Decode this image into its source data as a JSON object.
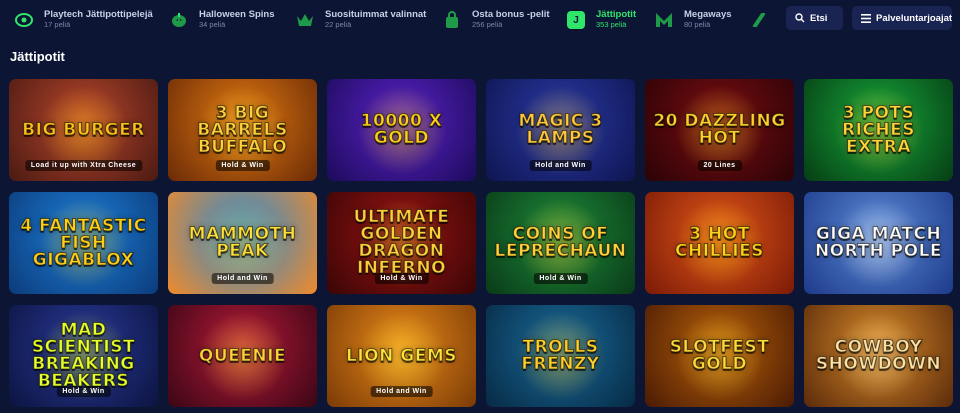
{
  "topbar": {
    "categories": [
      {
        "name": "Playtech Jättipottipelejä",
        "count": "17 peliä",
        "icon": "playtech-logo-icon",
        "active": false
      },
      {
        "name": "Halloween Spins",
        "count": "34 peliä",
        "icon": "pumpkin-icon",
        "active": false
      },
      {
        "name": "Suosituimmat valinnat",
        "count": "22 peliä",
        "icon": "crown-icon",
        "active": false
      },
      {
        "name": "Osta bonus -pelit",
        "count": "256 peliä",
        "icon": "shopping-bag-icon",
        "active": false
      },
      {
        "name": "Jättipotit",
        "count": "353 peliä",
        "icon": "jackpot-j-icon",
        "badge": "J",
        "active": true
      },
      {
        "name": "Megaways",
        "count": "80 peliä",
        "icon": "megaways-m-icon",
        "active": false
      }
    ],
    "search_label": "Etsi",
    "providers_label": "Palveluntarjoajat"
  },
  "section_title": "Jättipotit",
  "games": [
    {
      "title": "Big Burger",
      "subtitle": "Load it up with Xtra Cheese",
      "bg": "#b9462d",
      "bg2": "#4a1a12",
      "accent": "#ffc21a"
    },
    {
      "title": "3 Big Barrels Buffalo",
      "subtitle": "Hold & Win",
      "bg": "#e07a12",
      "bg2": "#6b2a06",
      "accent": "#ffd23a"
    },
    {
      "title": "10000 X Gold",
      "subtitle": "",
      "bg": "#5b22c9",
      "bg2": "#1c0b5a",
      "accent": "#ffcf1a"
    },
    {
      "title": "Magic 3 Lamps",
      "subtitle": "Hold and Win",
      "bg": "#2a3aa6",
      "bg2": "#0e1550",
      "accent": "#ffc93a"
    },
    {
      "title": "20 Dazzling Hot",
      "subtitle": "20 Lines",
      "bg": "#7a0d12",
      "bg2": "#2a0306",
      "accent": "#ffcf2a"
    },
    {
      "title": "3 Pots Riches Extra",
      "subtitle": "",
      "bg": "#16a63a",
      "bg2": "#063d14",
      "accent": "#ffd53a"
    },
    {
      "title": "4 Fantastic Fish Gigablox",
      "subtitle": "",
      "bg": "#1e7fd8",
      "bg2": "#0b3b7a",
      "accent": "#ffd01a"
    },
    {
      "title": "Mammoth Peak",
      "subtitle": "Hold and Win",
      "bg": "#2e8ad2",
      "bg2": "#f08a2a",
      "accent": "#ffe03a"
    },
    {
      "title": "Ultimate Golden Dragon Inferno",
      "subtitle": "Hold & Win",
      "bg": "#9a1414",
      "bg2": "#3a0505",
      "accent": "#ffcf3a"
    },
    {
      "title": "Coins of Leprechaun",
      "subtitle": "Hold & Win",
      "bg": "#1d8a3a",
      "bg2": "#0a3a18",
      "accent": "#ffd23a"
    },
    {
      "title": "3 Hot Chillies",
      "subtitle": "",
      "bg": "#e0561a",
      "bg2": "#7a1a06",
      "accent": "#ffd21a"
    },
    {
      "title": "Giga Match North Pole",
      "subtitle": "",
      "bg": "#5b8ad6",
      "bg2": "#1d3a8a",
      "accent": "#ffffff"
    },
    {
      "title": "Mad Scientist Breaking Beakers",
      "subtitle": "Hold & Win",
      "bg": "#2a3a9a",
      "bg2": "#0c1440",
      "accent": "#e7ff2a"
    },
    {
      "title": "Queenie",
      "subtitle": "",
      "bg": "#b51a3a",
      "bg2": "#3a0614",
      "accent": "#ffd23a"
    },
    {
      "title": "Lion Gems",
      "subtitle": "Hold and Win",
      "bg": "#e88a1a",
      "bg2": "#7a3a06",
      "accent": "#ffe23a"
    },
    {
      "title": "Trolls Frenzy",
      "subtitle": "",
      "bg": "#1a6a9a",
      "bg2": "#062a44",
      "accent": "#ffcf2a"
    },
    {
      "title": "Slotfest Gold",
      "subtitle": "",
      "bg": "#b8620a",
      "bg2": "#4a1a04",
      "accent": "#ffd83a"
    },
    {
      "title": "Cowboy Showdown",
      "subtitle": "",
      "bg": "#d88a2a",
      "bg2": "#5a2a0a",
      "accent": "#ffe2a0"
    }
  ],
  "colors": {
    "background": "#0d1535",
    "accent": "#2fe56a",
    "button": "#1a2452"
  }
}
